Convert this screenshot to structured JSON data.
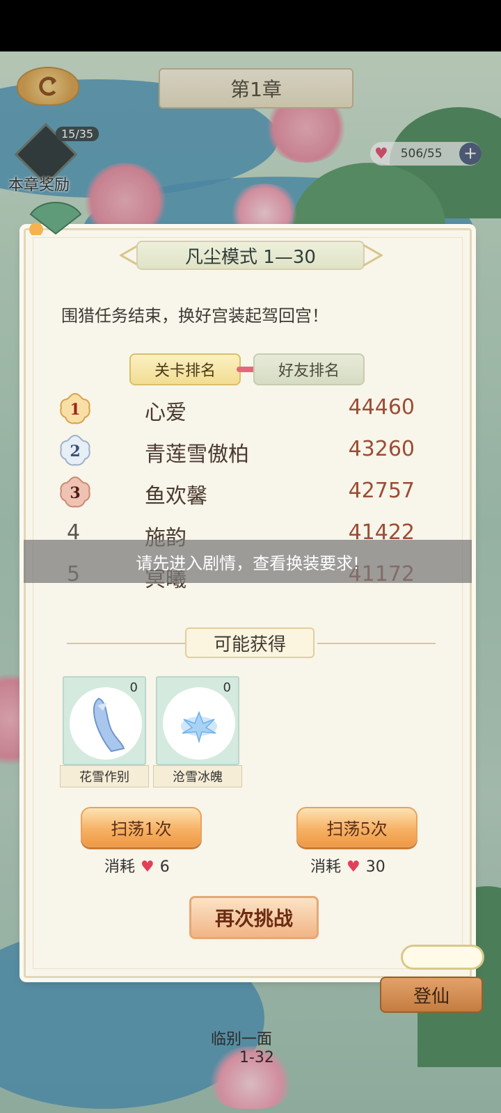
{
  "header": {
    "chapter_title": "第1章"
  },
  "chapter_reward": {
    "count": "15/35",
    "label": "本章奖励"
  },
  "stamina": {
    "value": "506/55",
    "plus": "+"
  },
  "panel": {
    "mode_title": "凡尘模式 1—30",
    "story_text": "围猎任务结束，换好宫装起驾回宫！",
    "tabs": {
      "stage_rank": "关卡排名",
      "friend_rank": "好友排名"
    },
    "rankings": [
      {
        "rank": "1",
        "name": "心爱",
        "score": "44460"
      },
      {
        "rank": "2",
        "name": "青莲雪傲柏",
        "score": "43260"
      },
      {
        "rank": "3",
        "name": "鱼欢馨",
        "score": "42757"
      },
      {
        "rank": "4",
        "name": "施韵",
        "score": "41422"
      },
      {
        "rank": "5",
        "name": "冥曦",
        "score": "41172"
      }
    ],
    "obtain_title": "可能获得",
    "items": [
      {
        "name": "花雪作别",
        "count": "0",
        "icon": "crystal-shoe-icon"
      },
      {
        "name": "沧雪冰魄",
        "count": "0",
        "icon": "ice-crystal-icon"
      }
    ],
    "sweep1": {
      "label": "扫荡1次",
      "cost_label": "消耗",
      "cost": "6"
    },
    "sweep5": {
      "label": "扫荡5次",
      "cost_label": "消耗",
      "cost": "30"
    },
    "retry_label": "再次挑战"
  },
  "toast": "请先进入剧情，查看换装要求!",
  "map": {
    "dengxian": "登仙",
    "next_level_name": "临别一面",
    "next_level_id": "1-32"
  },
  "colors": {
    "accent_orange": "#f6b266",
    "heart": "#e04058",
    "score": "#9b4d35"
  }
}
